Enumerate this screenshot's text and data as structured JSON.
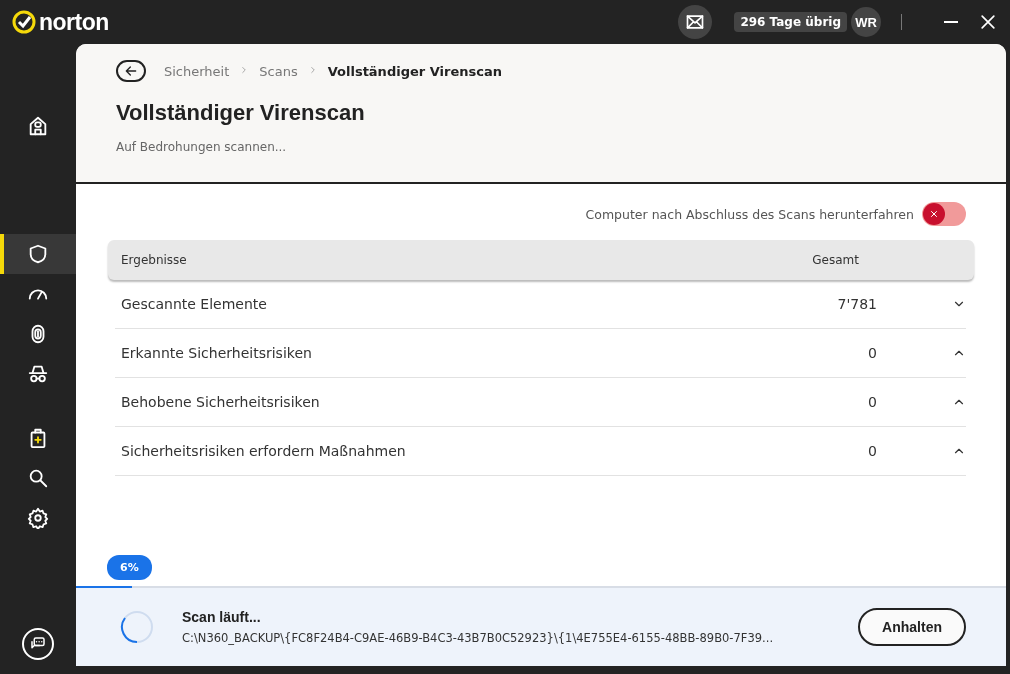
{
  "app": {
    "logo": "norton",
    "days_left": "296 Tage übrig",
    "avatar": "WR"
  },
  "sidebar": {
    "items": [
      {
        "kind": "home",
        "selected": false
      },
      {
        "kind": "shield",
        "selected": true
      },
      {
        "kind": "gauge",
        "selected": false
      },
      {
        "kind": "fingerprint",
        "selected": false
      },
      {
        "kind": "incognito",
        "selected": false
      },
      {
        "kind": "medkit",
        "selected": false
      },
      {
        "kind": "search",
        "selected": false
      },
      {
        "kind": "gear",
        "selected": false
      }
    ]
  },
  "breadcrumb": [
    {
      "label": "Sicherheit",
      "current": false
    },
    {
      "label": "Scans",
      "current": false
    },
    {
      "label": "Vollständiger Virenscan",
      "current": true
    }
  ],
  "title": "Vollständiger Virenscan",
  "subtitle": "Auf Bedrohungen scannen...",
  "shutdown_toggle": {
    "label": "Computer nach Abschluss des Scans herunterfahren",
    "on": false
  },
  "table": {
    "columns": [
      "Ergebnisse",
      "Gesamt"
    ],
    "rows": [
      {
        "label": "Gescannte Elemente",
        "value": "7'781",
        "expanded": false
      },
      {
        "label": "Erkannte Sicherheitsrisiken",
        "value": "0",
        "expanded": true
      },
      {
        "label": "Behobene Sicherheitsrisiken",
        "value": "0",
        "expanded": true
      },
      {
        "label": "Sicherheitsrisiken erfordern Maßnahmen",
        "value": "0",
        "expanded": true
      }
    ]
  },
  "progress": {
    "level": 0.06,
    "percent": "6%",
    "status": "Scan läuft...",
    "path": "C:\\N360_BACKUP\\{FC8F24B4-C9AE-46B9-B4C3-43B7B0C52923}\\{1\\4E755E4-6155-48BB-89B0-7F39...",
    "button": "Anhalten"
  }
}
